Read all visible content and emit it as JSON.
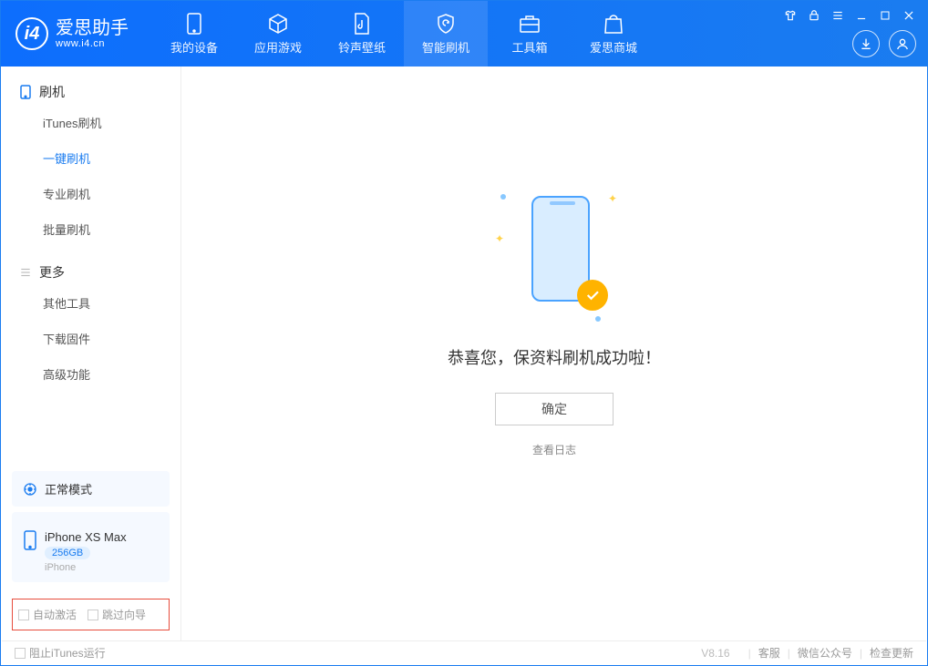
{
  "brand": {
    "name": "爱思助手",
    "site": "www.i4.cn"
  },
  "topTabs": [
    {
      "label": "我的设备"
    },
    {
      "label": "应用游戏"
    },
    {
      "label": "铃声壁纸"
    },
    {
      "label": "智能刷机"
    },
    {
      "label": "工具箱"
    },
    {
      "label": "爱思商城"
    }
  ],
  "sidebar": {
    "section1": {
      "title": "刷机",
      "items": [
        "iTunes刷机",
        "一键刷机",
        "专业刷机",
        "批量刷机"
      ]
    },
    "section2": {
      "title": "更多",
      "items": [
        "其他工具",
        "下载固件",
        "高级功能"
      ]
    }
  },
  "deviceMode": "正常模式",
  "device": {
    "name": "iPhone XS Max",
    "capacity": "256GB",
    "type": "iPhone"
  },
  "options": {
    "autoActivate": "自动激活",
    "skipGuide": "跳过向导"
  },
  "main": {
    "successText": "恭喜您，保资料刷机成功啦！",
    "okLabel": "确定",
    "viewLog": "查看日志"
  },
  "status": {
    "blockItunes": "阻止iTunes运行",
    "version": "V8.16",
    "support": "客服",
    "wechat": "微信公众号",
    "update": "检查更新"
  }
}
